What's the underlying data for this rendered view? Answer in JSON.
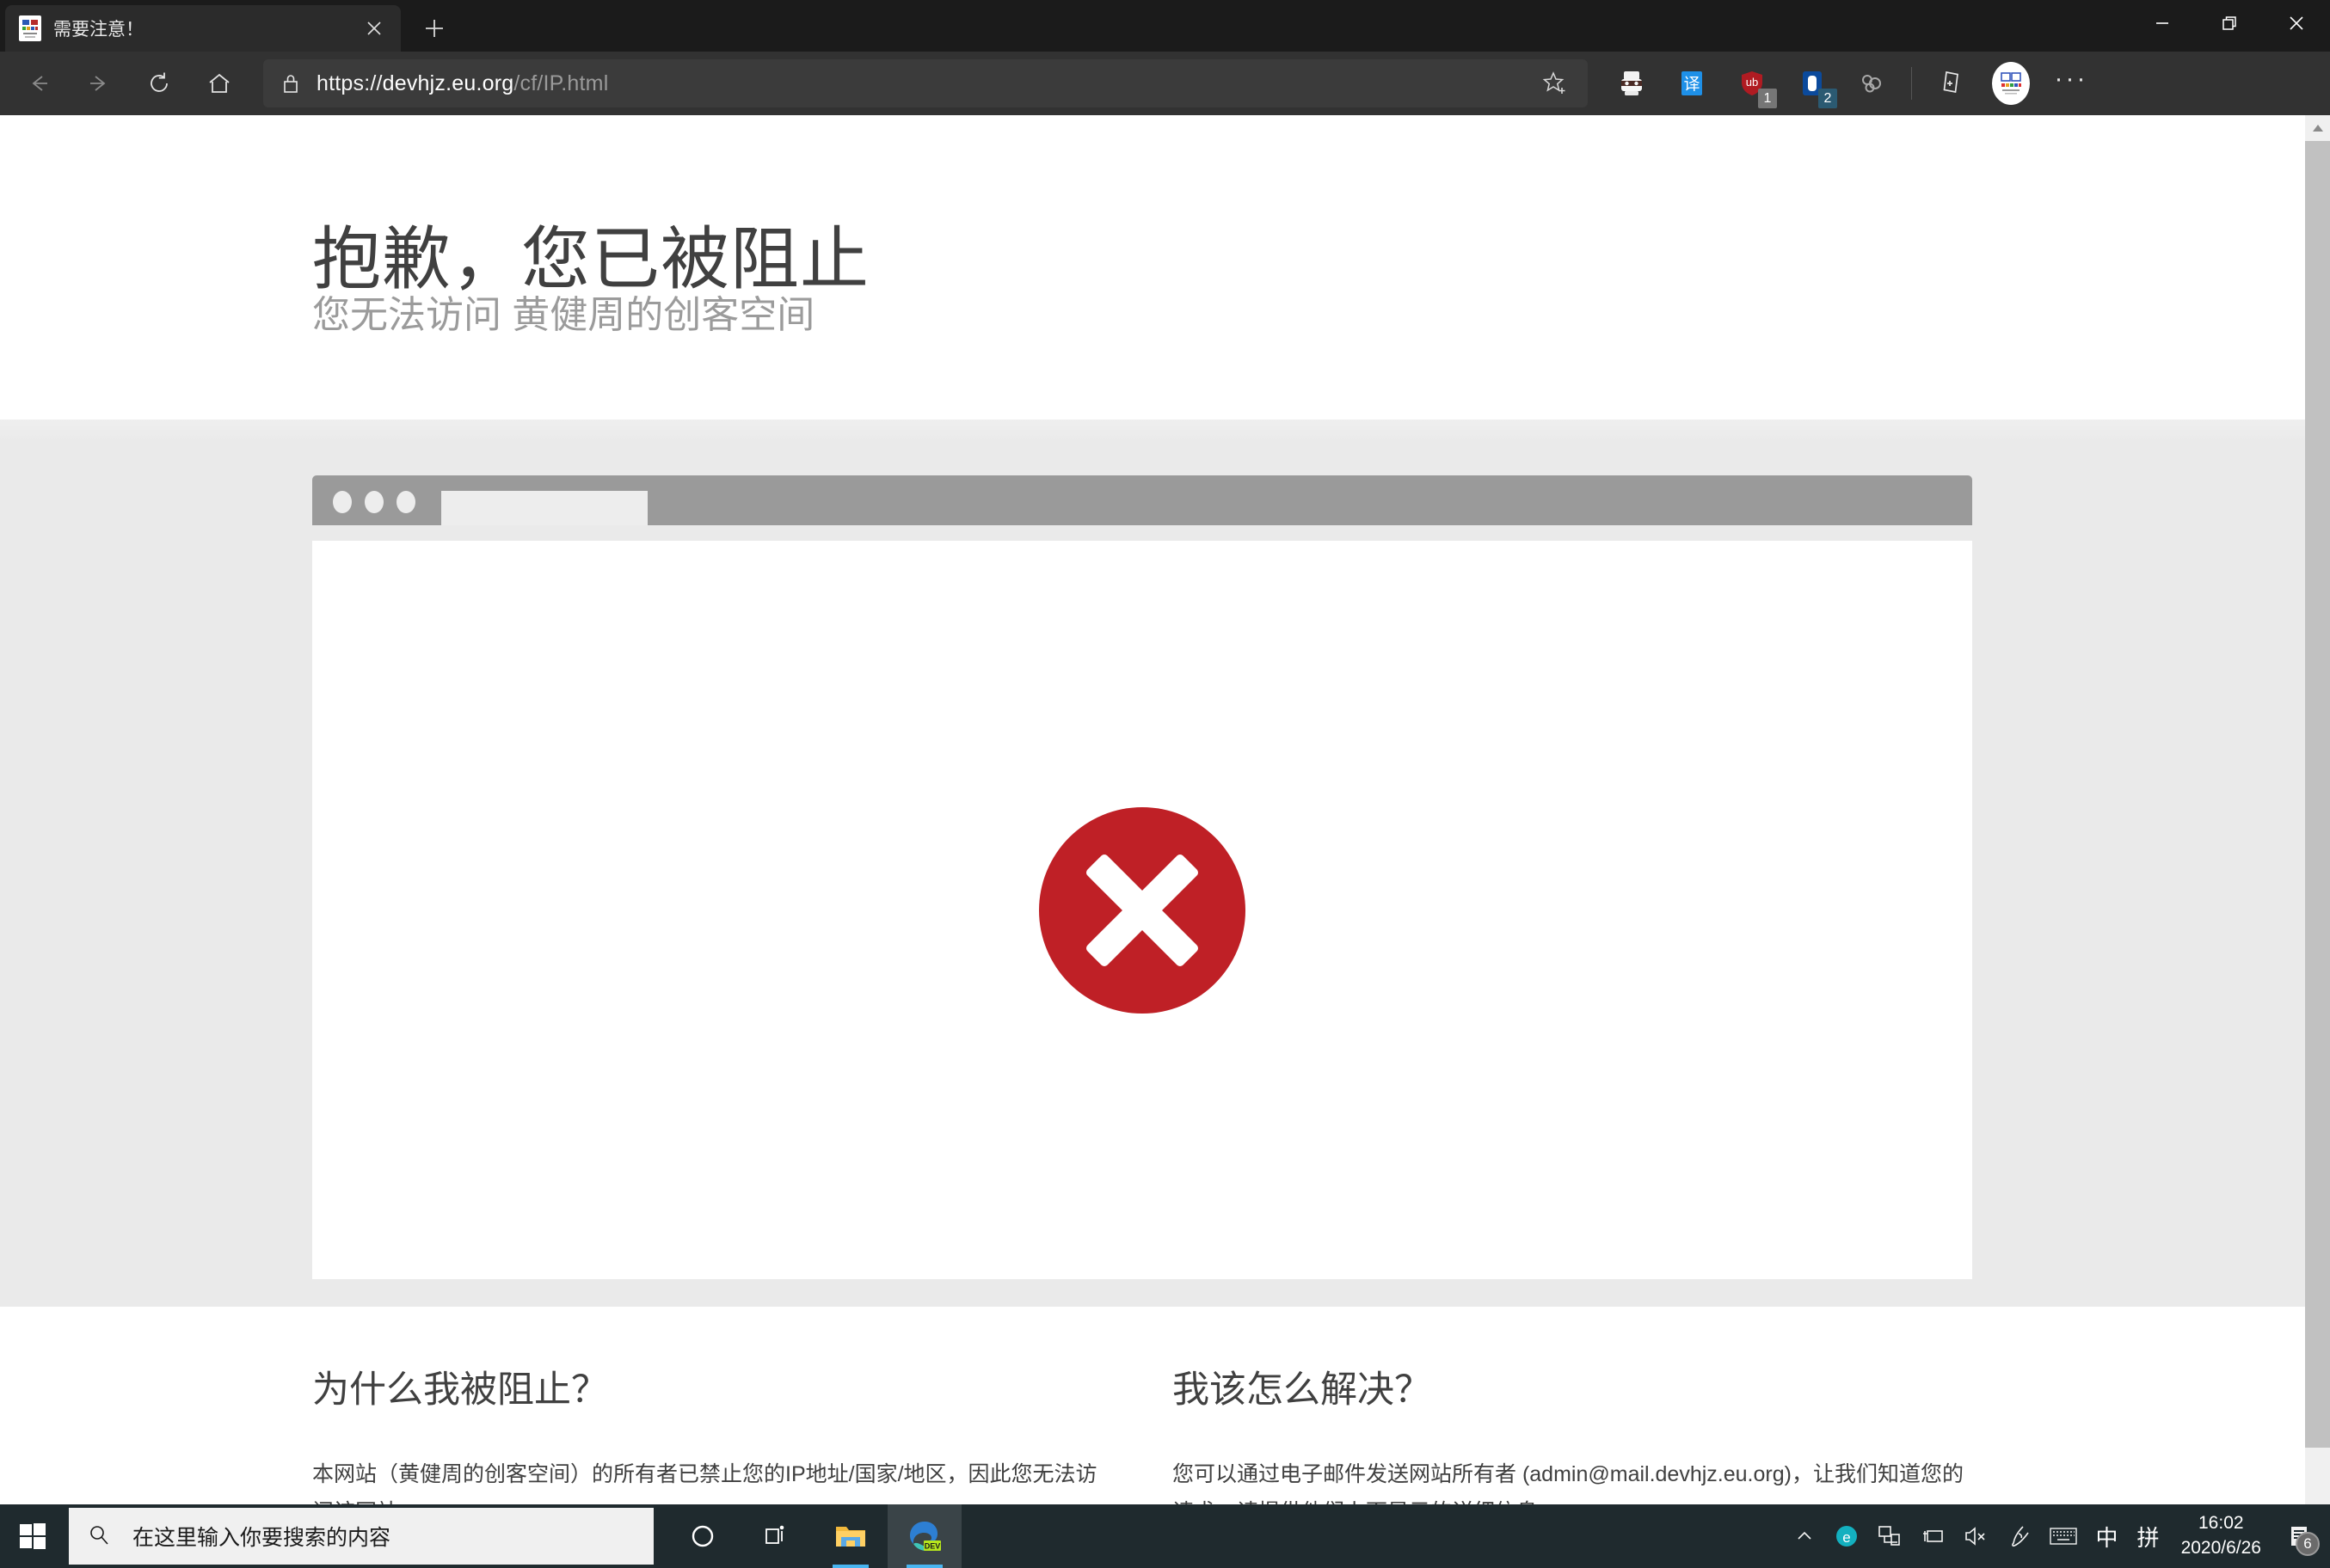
{
  "browser": {
    "tab": {
      "title": "需要注意！",
      "favicon_icon": "site-favicon",
      "close_icon": "close-icon"
    },
    "new_tab_label": "+",
    "window_controls": {
      "minimize": "minimize-icon",
      "restore": "restore-icon",
      "close": "close-icon"
    },
    "nav": {
      "back_icon": "back-arrow-icon",
      "forward_icon": "forward-arrow-icon",
      "refresh_icon": "refresh-icon",
      "home_icon": "home-icon"
    },
    "address_bar": {
      "lock_icon": "lock-icon",
      "url_scheme": "https://",
      "url_host": "devhjz.eu.org",
      "url_path": "/cf/IP.html",
      "favorite_icon": "star-add-icon"
    },
    "extensions": [
      {
        "name": "adblock-mask-icon",
        "badge": ""
      },
      {
        "name": "translate-icon",
        "label": "译",
        "badge": ""
      },
      {
        "name": "ublock-shield-icon",
        "label": "ub",
        "badge": "1"
      },
      {
        "name": "tampermonkey-icon",
        "badge": "2"
      },
      {
        "name": "chainlink-icon",
        "badge": ""
      }
    ],
    "collections_icon": "collections-icon",
    "profile_icon": "profile-avatar",
    "settings_icon": "more-ellipsis-icon",
    "scrollbar": {
      "up_arrow": "scroll-up-arrow"
    }
  },
  "page": {
    "heading": "抱歉，您已被阻止",
    "subheading": "您无法访问 黄健周的创客空间",
    "error_icon": "error-cross-icon",
    "mock_browser": {
      "dots": [
        "dot-1",
        "dot-2",
        "dot-3"
      ],
      "tab": "mock-tab"
    },
    "columns": [
      {
        "title": "为什么我被阻止？",
        "body": "本网站（黄健周的创客空间）的所有者已禁止您的IP地址/国家/地区，因此您无法访问该网站。"
      },
      {
        "title": "我该怎么解决？",
        "body": "您可以通过电子邮件发送网站所有者 (admin@mail.devhjz.eu.org)，让我们知道您的请求。请提供他们上面显示的详细信息。"
      }
    ]
  },
  "taskbar": {
    "start_icon": "windows-start-icon",
    "search": {
      "icon": "search-icon",
      "placeholder": "在这里输入你要搜索的内容"
    },
    "apps": [
      {
        "name": "cortana-icon",
        "active": false
      },
      {
        "name": "task-view-icon",
        "active": false
      },
      {
        "name": "file-explorer-icon",
        "active": false
      },
      {
        "name": "edge-dev-icon",
        "active": true,
        "label": "DEV"
      }
    ],
    "tray": {
      "overflow_icon": "chevron-up-icon",
      "edge_icon": "edge-tray-icon",
      "network_icon": "network-icon",
      "battery_icon": "battery-icon",
      "volume_icon": "volume-muted-icon",
      "pen_icon": "pen-icon",
      "keyboard_icon": "touch-keyboard-icon",
      "ime_mode": "中",
      "ime_pinyin": "拼"
    },
    "clock": {
      "time": "16:02",
      "date": "2020/6/26"
    },
    "notifications": {
      "icon": "notification-icon",
      "count": "6"
    }
  },
  "colors": {
    "error_red": "#bf2026",
    "chrome_dark": "#1b1b1b",
    "toolbar": "#323232",
    "band_gray": "#eaeaea",
    "taskbar": "#1f2a2e",
    "accent_blue": "#49b5f0"
  }
}
